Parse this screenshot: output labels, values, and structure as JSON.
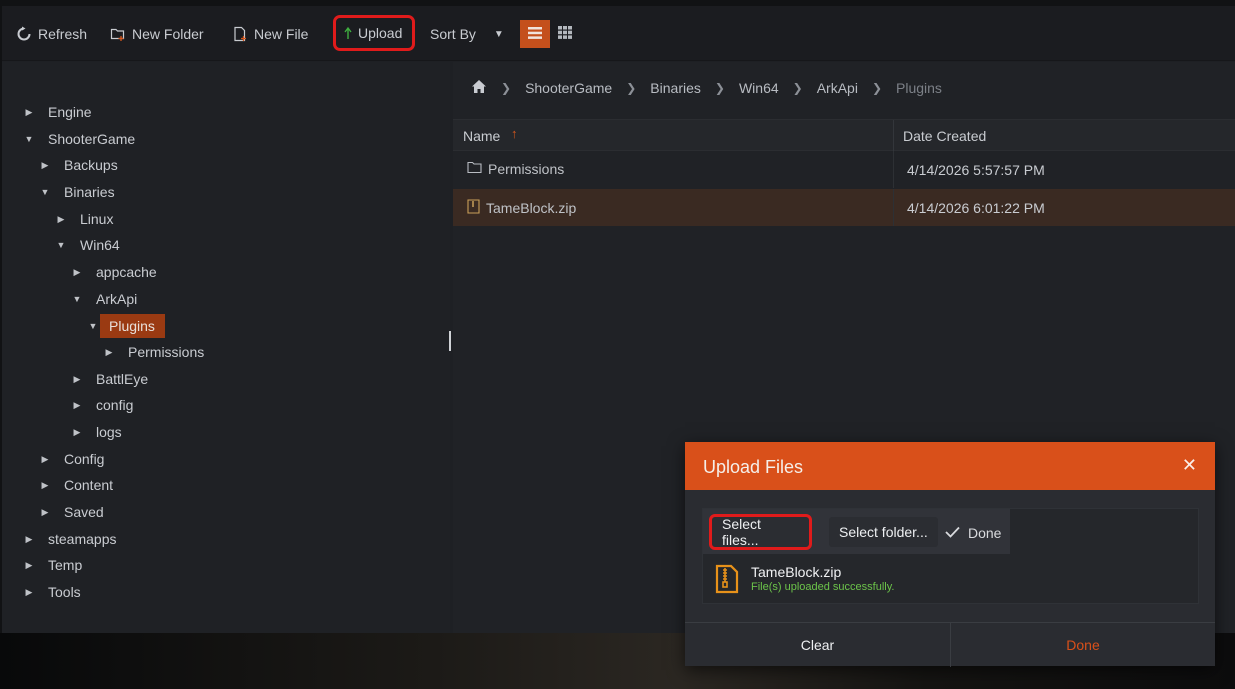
{
  "toolbar": {
    "refresh": "Refresh",
    "new_folder": "New Folder",
    "new_file": "New File",
    "upload": "Upload",
    "sort_by": "Sort By"
  },
  "tree": {
    "items": [
      {
        "label": "Engine",
        "expanded": false
      },
      {
        "label": "ShooterGame",
        "expanded": true
      },
      {
        "label": "Backups",
        "expanded": false
      },
      {
        "label": "Binaries",
        "expanded": true
      },
      {
        "label": "Linux",
        "expanded": false
      },
      {
        "label": "Win64",
        "expanded": true
      },
      {
        "label": "appcache",
        "expanded": false
      },
      {
        "label": "ArkApi",
        "expanded": true
      },
      {
        "label": "Plugins",
        "expanded": true,
        "selected": true
      },
      {
        "label": "Permissions",
        "expanded": false
      },
      {
        "label": "BattlEye",
        "expanded": false
      },
      {
        "label": "config",
        "expanded": false
      },
      {
        "label": "logs",
        "expanded": false
      },
      {
        "label": "Config",
        "expanded": false
      },
      {
        "label": "Content",
        "expanded": false
      },
      {
        "label": "Saved",
        "expanded": false
      },
      {
        "label": "steamapps",
        "expanded": false
      },
      {
        "label": "Temp",
        "expanded": false
      },
      {
        "label": "Tools",
        "expanded": false
      }
    ]
  },
  "breadcrumb": [
    "ShooterGame",
    "Binaries",
    "Win64",
    "ArkApi",
    "Plugins"
  ],
  "grid": {
    "columns": {
      "name": "Name",
      "date": "Date Created"
    },
    "rows": [
      {
        "name": "Permissions",
        "type": "folder",
        "date": "4/14/2026 5:57:57 PM"
      },
      {
        "name": "TameBlock.zip",
        "type": "zip",
        "date": "4/14/2026 6:01:22 PM"
      }
    ]
  },
  "dialog": {
    "title": "Upload Files",
    "select_files": "Select files...",
    "select_folder": "Select folder...",
    "done_status": "Done",
    "file_name": "TameBlock.zip",
    "file_status": "File(s) uploaded successfully.",
    "clear": "Clear",
    "done": "Done"
  },
  "colors": {
    "accent": "#d9501a",
    "success": "#6cc44a",
    "highlight": "#e01b1b"
  }
}
